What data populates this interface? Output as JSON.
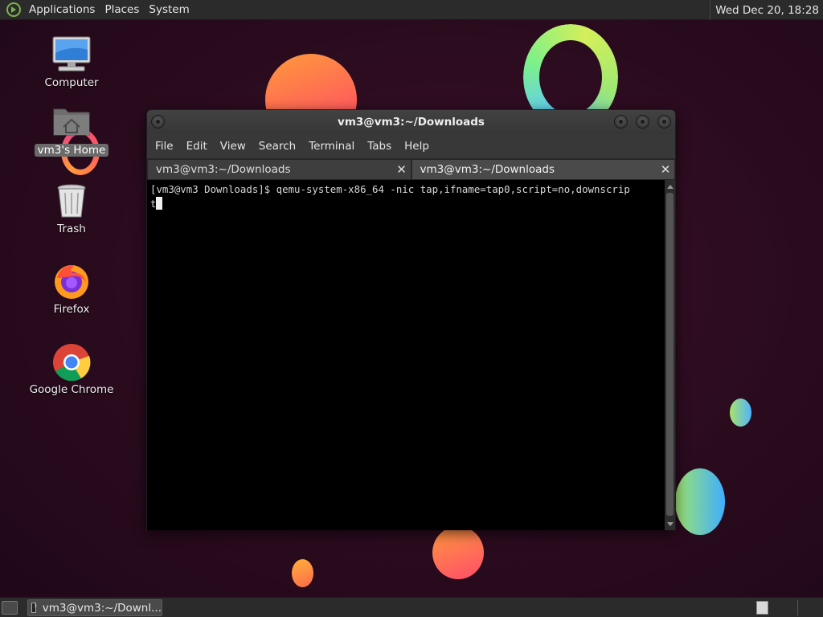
{
  "top_panel": {
    "menus": [
      "Applications",
      "Places",
      "System"
    ],
    "clock": "Wed Dec 20, 18:28"
  },
  "desktop_icons": [
    {
      "label": "Computer",
      "icon": "computer-icon"
    },
    {
      "label": "vm3's Home",
      "icon": "home-folder-icon",
      "selected": true
    },
    {
      "label": "Trash",
      "icon": "trash-icon"
    },
    {
      "label": "Firefox",
      "icon": "firefox-icon"
    },
    {
      "label": "Google Chrome",
      "icon": "chrome-icon"
    }
  ],
  "window": {
    "title": "vm3@vm3:~/Downloads",
    "menu": [
      "File",
      "Edit",
      "View",
      "Search",
      "Terminal",
      "Tabs",
      "Help"
    ],
    "tabs": [
      {
        "label": "vm3@vm3:~/Downloads",
        "active": false
      },
      {
        "label": "vm3@vm3:~/Downloads",
        "active": true
      }
    ],
    "terminal": {
      "line1": "[vm3@vm3 Downloads]$ qemu-system-x86_64 -nic tap,ifname=tap0,script=no,downscrip",
      "line2": "t"
    }
  },
  "taskbar": {
    "task_label": "vm3@vm3:~/Downl..."
  },
  "colors": {
    "panel_bg": "#2b2b2b",
    "terminal_bg": "#000000",
    "wallpaper_bg": "#2a0b1e"
  }
}
